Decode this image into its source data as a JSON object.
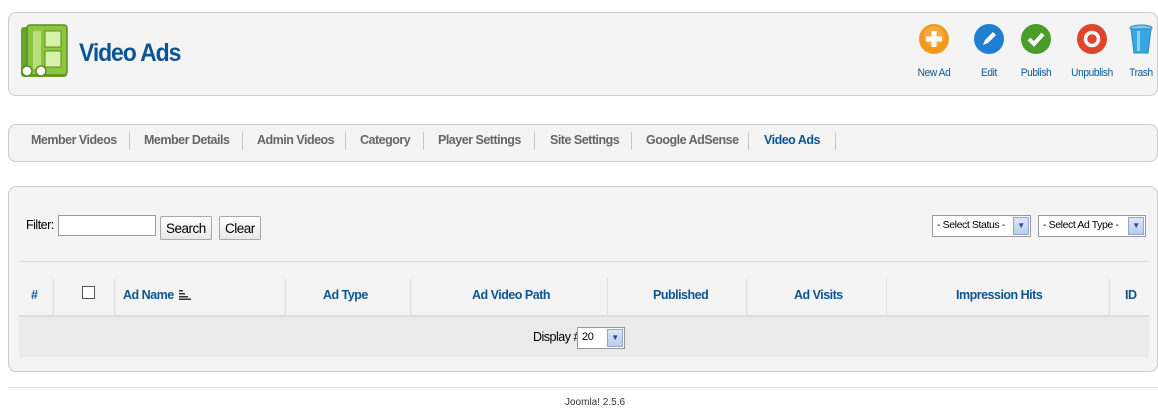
{
  "header": {
    "title": "Video Ads",
    "logo_icon": "film-strip-icon",
    "buttons": [
      {
        "label": "New Ad",
        "icon": "plus-circle-icon",
        "color": "#f39a1e"
      },
      {
        "label": "Edit",
        "icon": "pencil-circle-icon",
        "color": "#1f7fd1"
      },
      {
        "label": "Publish",
        "icon": "check-circle-icon",
        "color": "#4a9d2a"
      },
      {
        "label": "Unpublish",
        "icon": "stop-circle-icon",
        "color": "#e0452b"
      },
      {
        "label": "Trash",
        "icon": "trash-icon",
        "color": "#3aa8e0"
      }
    ]
  },
  "tabs": [
    {
      "label": "Member Videos",
      "active": false
    },
    {
      "label": "Member Details",
      "active": false
    },
    {
      "label": "Admin Videos",
      "active": false
    },
    {
      "label": "Category",
      "active": false
    },
    {
      "label": "Player Settings",
      "active": false
    },
    {
      "label": "Site Settings",
      "active": false
    },
    {
      "label": "Google AdSense",
      "active": false
    },
    {
      "label": "Video Ads",
      "active": true
    }
  ],
  "filter": {
    "label": "Filter:",
    "value": "",
    "search_label": "Search",
    "clear_label": "Clear",
    "status_select": "- Select Status -",
    "adtype_select": "- Select Ad Type -"
  },
  "table": {
    "columns": [
      "#",
      "",
      "Ad Name",
      "Ad Type",
      "Ad Video Path",
      "Published",
      "Ad Visits",
      "Impression Hits",
      "ID"
    ],
    "rows": [],
    "display_label": "Display #",
    "display_value": "20"
  },
  "footer": {
    "text": "Joomla! 2.5.6"
  },
  "colors": {
    "accent": "#0b5594",
    "panel": "#f4f4f4",
    "border": "#cccccc"
  }
}
